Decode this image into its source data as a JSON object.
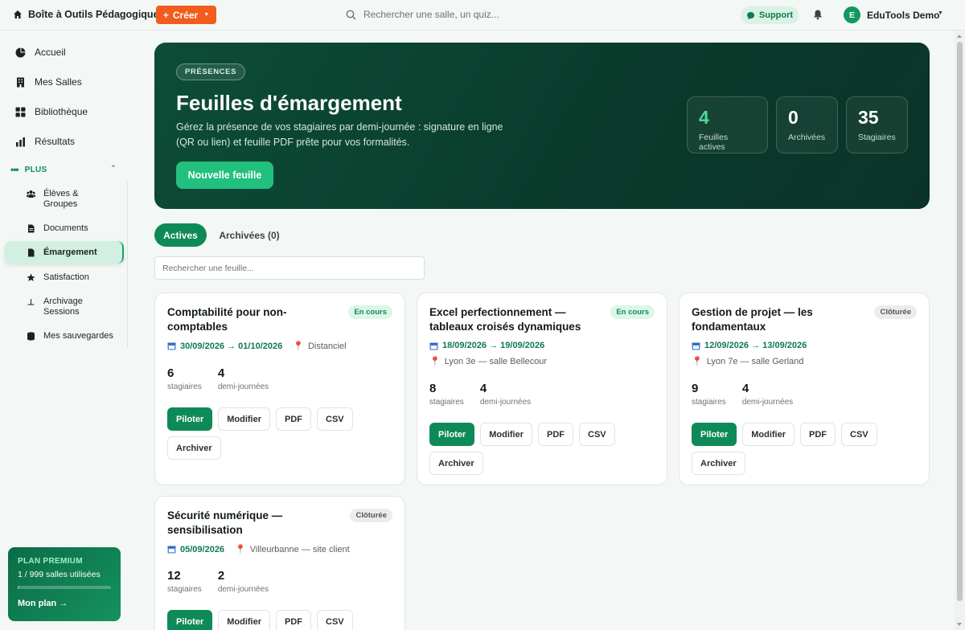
{
  "topbar": {
    "brand": "Boîte à Outils Pédagogique",
    "create": "Créer",
    "search_placeholder": "Rechercher une salle, un quiz...",
    "support": "Support",
    "avatar_initial": "E",
    "user": "EduTools Demo"
  },
  "sidebar": {
    "items": [
      {
        "label": "Accueil",
        "icon": "pie-icon"
      },
      {
        "label": "Mes Salles",
        "icon": "building-icon"
      },
      {
        "label": "Bibliothèque",
        "icon": "grid-icon"
      },
      {
        "label": "Résultats",
        "icon": "bar-chart-icon"
      }
    ],
    "plus_label": "PLUS",
    "sub_items": [
      {
        "label_1": "Élèves &",
        "label_2": "Groupes",
        "icon": "users-icon"
      },
      {
        "label": "Documents",
        "icon": "document-icon"
      },
      {
        "label": "Émargement",
        "icon": "sheet-icon",
        "active": true
      },
      {
        "label": "Satisfaction",
        "icon": "star-icon"
      },
      {
        "label_1": "Archivage",
        "label_2": "Sessions",
        "icon": "archive-icon"
      },
      {
        "label": "Mes sauvegardes",
        "icon": "database-icon"
      }
    ],
    "premium": {
      "title": "PLAN PREMIUM",
      "usage": "1 / 999 salles utilisées",
      "usage_fraction": 0.001,
      "link": "Mon plan →"
    }
  },
  "hero": {
    "badge": "PRÉSENCES",
    "title": "Feuilles d'émargement",
    "description": "Gérez la présence de vos stagiaires par demi-journée : signature en ligne (QR ou lien) et feuille PDF prête pour vos formalités.",
    "button": "Nouvelle feuille",
    "stats": [
      {
        "value": "4",
        "label": "Feuilles actives"
      },
      {
        "value": "0",
        "label": "Archivées"
      },
      {
        "value": "35",
        "label": "Stagiaires"
      }
    ]
  },
  "tabs": {
    "active": "Actives",
    "archived": "Archivées (0)"
  },
  "sheet_search_placeholder": "Rechercher une feuille...",
  "labels": {
    "trainees": "stagiaires",
    "half_days": "demi-journées",
    "pilot": "Piloter",
    "edit": "Modifier",
    "pdf": "PDF",
    "csv": "CSV",
    "archive": "Archiver"
  },
  "cards": [
    {
      "title": "Comptabilité pour non-comptables",
      "status": "En cours",
      "dates": "30/09/2026 → 01/10/2026",
      "location": "Distanciel",
      "trainees": "6",
      "half_days": "4"
    },
    {
      "title": "Excel perfectionnement — tableaux croisés dynamiques",
      "status": "En cours",
      "dates": "18/09/2026 → 19/09/2026",
      "location": "Lyon 3e — salle Bellecour",
      "trainees": "8",
      "half_days": "4"
    },
    {
      "title": "Gestion de projet — les fondamentaux",
      "status": "Clôturée",
      "dates": "12/09/2026 → 13/09/2026",
      "location": "Lyon 7e — salle Gerland",
      "trainees": "9",
      "half_days": "4"
    },
    {
      "title": "Sécurité numérique — sensibilisation",
      "status": "Clôturée",
      "dates": "05/09/2026",
      "location": "Villeurbanne — site client",
      "trainees": "12",
      "half_days": "2"
    }
  ],
  "colors": {
    "accent": "#0e8a58",
    "create_button": "#f25c1e",
    "hero_bg": "#0b3f2e",
    "status_active_bg": "#dcf6e8",
    "status_closed_bg": "#ececec"
  }
}
